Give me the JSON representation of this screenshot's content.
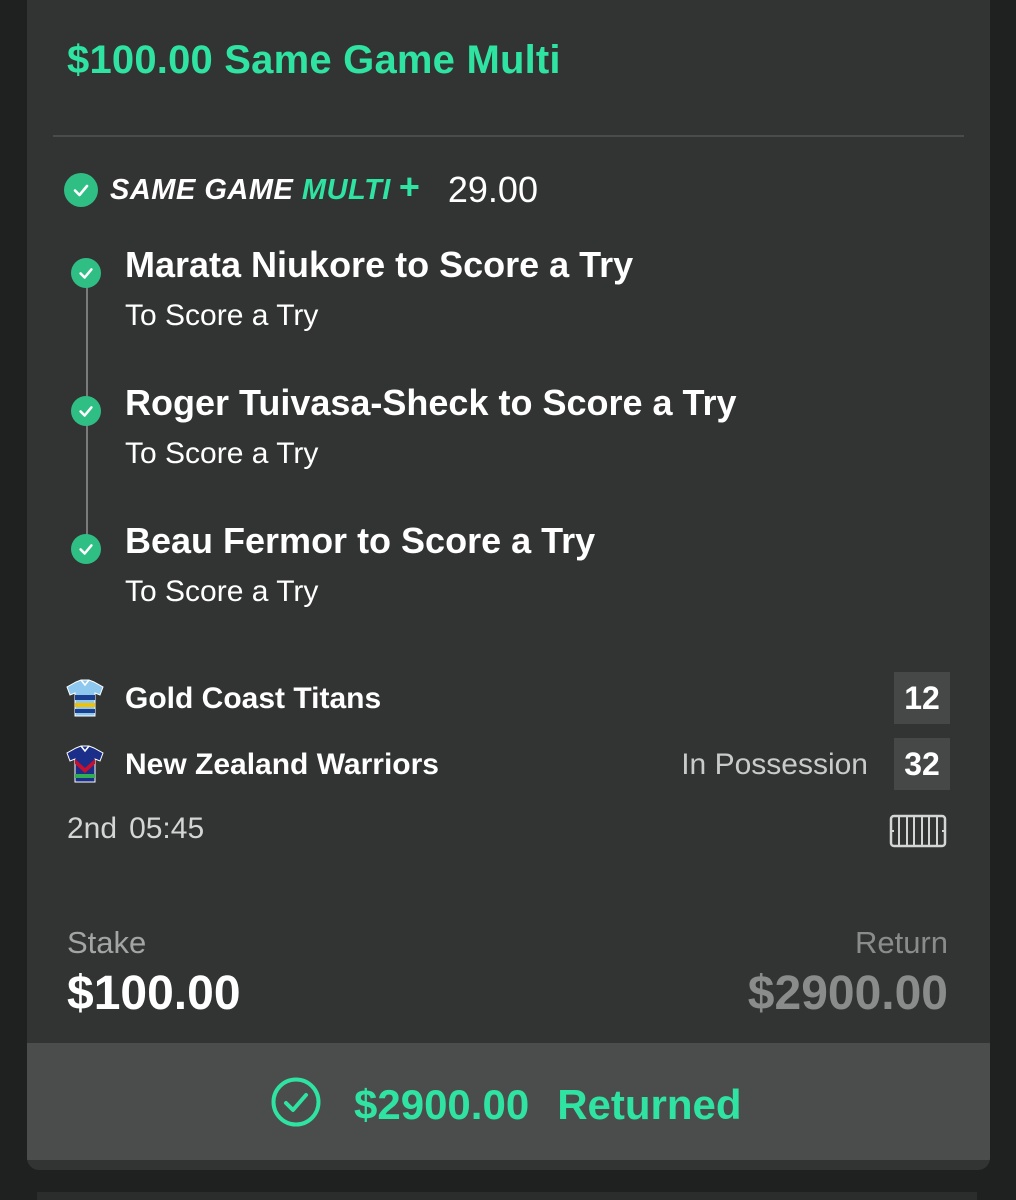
{
  "header": {
    "title": "$100.00 Same Game Multi"
  },
  "sgm": {
    "logo_prefix": "SAME GAME",
    "logo_multi": "MULTI",
    "logo_plus": "+",
    "odds": "29.00"
  },
  "legs": [
    {
      "title": "Marata Niukore to Score a Try",
      "market": "To Score a Try",
      "status": "won"
    },
    {
      "title": "Roger Tuivasa-Sheck to Score a Try",
      "market": "To Score a Try",
      "status": "won"
    },
    {
      "title": "Beau Fermor to Score a Try",
      "market": "To Score a Try",
      "status": "won"
    }
  ],
  "match": {
    "teams": [
      {
        "name": "Gold Coast Titans",
        "score": "12",
        "possession": "",
        "jersey_icon": "titans-jersey-icon"
      },
      {
        "name": "New Zealand Warriors",
        "score": "32",
        "possession": "In Possession",
        "jersey_icon": "warriors-jersey-icon"
      }
    ],
    "period": "2nd",
    "time": "05:45"
  },
  "bet": {
    "stake_label": "Stake",
    "stake_value": "$100.00",
    "return_label": "Return",
    "return_value": "$2900.00"
  },
  "result": {
    "amount": "$2900.00",
    "status": "Returned"
  },
  "colors": {
    "accent": "#2fe3a2",
    "check": "#2fbf85",
    "card": "#323433",
    "background": "#1f2120"
  }
}
